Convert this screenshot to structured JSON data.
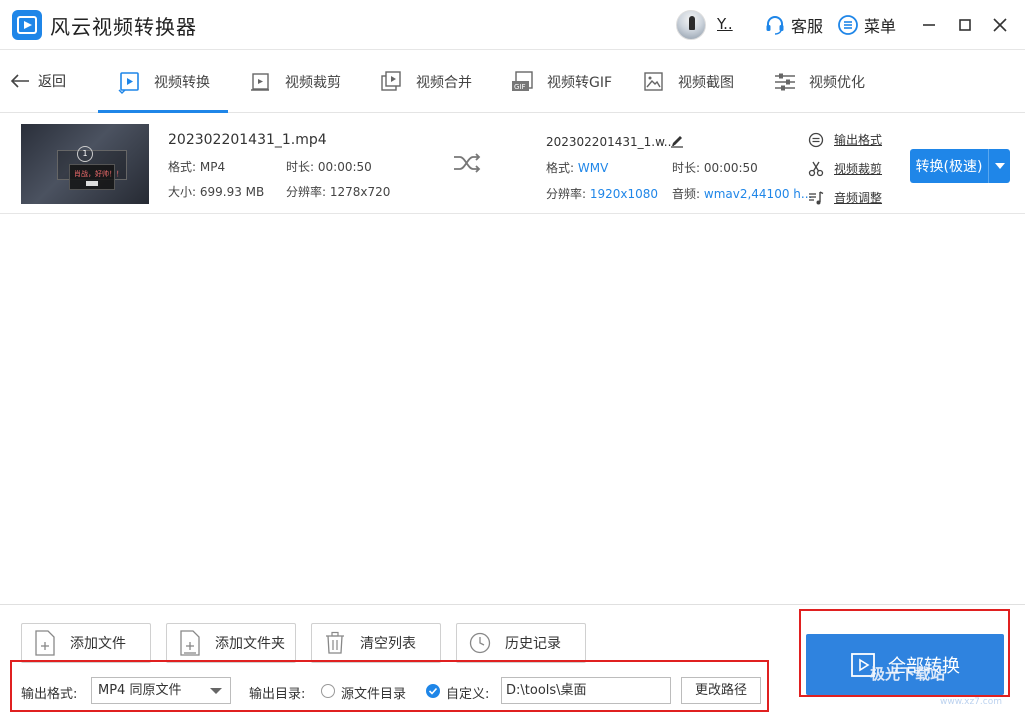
{
  "app": {
    "title": "风云视频转换器",
    "username": "Y..",
    "support_label": "客服",
    "menu_label": "菜单"
  },
  "nav": {
    "back_label": "返回",
    "tabs": [
      {
        "label": "视频转换",
        "icon": "play-icon",
        "active": true
      },
      {
        "label": "视频裁剪",
        "icon": "crop-icon"
      },
      {
        "label": "视频合并",
        "icon": "merge-icon"
      },
      {
        "label": "视频转GIF",
        "icon": "gif-icon"
      },
      {
        "label": "视频截图",
        "icon": "image-icon"
      },
      {
        "label": "视频优化",
        "icon": "sliders-icon"
      }
    ]
  },
  "file": {
    "thumb_text": "肖战，好帅！！",
    "thumb_number": "1",
    "source": {
      "name": "202302201431_1.mp4",
      "format_label": "格式:",
      "format": "MP4",
      "duration_label": "时长:",
      "duration": "00:00:50",
      "size_label": "大小:",
      "size": "699.93 MB",
      "resolution_label": "分辨率:",
      "resolution": "1278x720"
    },
    "output": {
      "name": "202302201431_1.w...",
      "format_label": "格式:",
      "format": "WMV",
      "duration_label": "时长:",
      "duration": "00:00:50",
      "resolution_label": "分辨率:",
      "resolution": "1920x1080",
      "audio_label": "音频:",
      "audio": "wmav2,44100 h..."
    },
    "actions": {
      "format": "输出格式",
      "crop": "视频裁剪",
      "audio": "音频调整"
    },
    "convert_label": "转换(极速)"
  },
  "bottom": {
    "add_file": "添加文件",
    "add_folder": "添加文件夹",
    "clear_list": "清空列表",
    "history": "历史记录",
    "output_format_label": "输出格式:",
    "output_format_value": "MP4 同原文件",
    "output_dir_label": "输出目录:",
    "source_dir_label": "源文件目录",
    "custom_label": "自定义:",
    "path_value": "D:\\tools\\桌面",
    "change_path": "更改路径",
    "convert_all": "全部转换"
  },
  "watermark": {
    "text": "极光下载站",
    "url": "www.xz7.com"
  },
  "colors": {
    "accent": "#1f86e8",
    "highlight": "#e02020"
  }
}
